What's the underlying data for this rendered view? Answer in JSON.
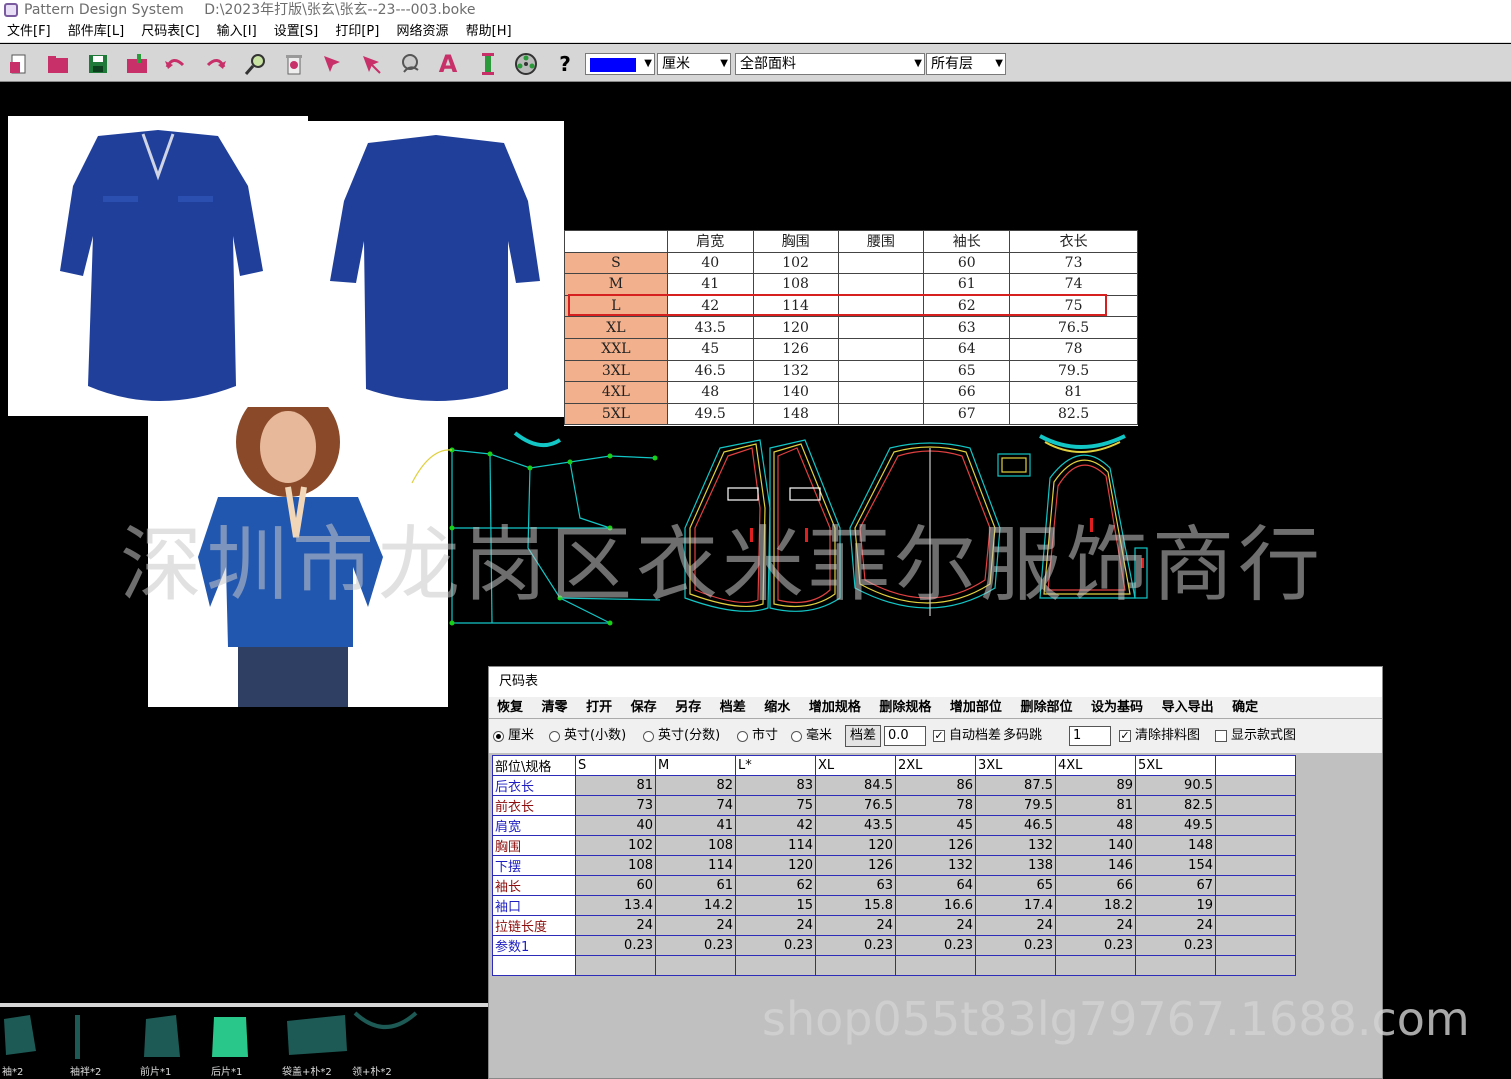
{
  "title": {
    "app": "Pattern Design System",
    "path": "D:\\2023年打版\\张玄\\张玄--23---003.boke"
  },
  "menu": [
    "文件[F]",
    "部件库[L]",
    "尺码表[C]",
    "输入[I]",
    "设置[S]",
    "打印[P]",
    "网络资源",
    "帮助[H]"
  ],
  "toolbar": {
    "icons": [
      "new-file-icon",
      "open-folder-icon",
      "save-icon",
      "import-icon",
      "undo-icon",
      "redo-icon",
      "zoom-icon",
      "delete-icon",
      "select-arrow-icon",
      "select-point-icon",
      "measure-icon",
      "text-icon",
      "grading-icon",
      "reel-icon",
      "help-icon"
    ],
    "help_label": "?",
    "text_label": "A",
    "unit": "厘米",
    "fabric": "全部面料",
    "layer": "所有层",
    "color_swatch": "#0000ff"
  },
  "size_chart_image": {
    "headers": [
      "",
      "肩宽",
      "胸围",
      "腰围",
      "袖长",
      "衣长"
    ],
    "rows": [
      [
        "S",
        "40",
        "102",
        "",
        "60",
        "73"
      ],
      [
        "M",
        "41",
        "108",
        "",
        "61",
        "74"
      ],
      [
        "L",
        "42",
        "114",
        "",
        "62",
        "75"
      ],
      [
        "XL",
        "43.5",
        "120",
        "",
        "63",
        "76.5"
      ],
      [
        "XXL",
        "45",
        "126",
        "",
        "64",
        "78"
      ],
      [
        "3XL",
        "46.5",
        "132",
        "",
        "65",
        "79.5"
      ],
      [
        "4XL",
        "48",
        "140",
        "",
        "66",
        "81"
      ],
      [
        "5XL",
        "49.5",
        "148",
        "",
        "67",
        "82.5"
      ]
    ],
    "highlight_color": "#d62020",
    "size_column_color": "#f3b08c"
  },
  "watermarks": {
    "company": "深圳市龙岗区衣米菲尔服饰商行",
    "shop": "shop055t83lg79767.1688.com"
  },
  "dialog": {
    "title": "尺码表",
    "menu": [
      "恢复",
      "清零",
      "打开",
      "保存",
      "另存",
      "档差",
      "缩水",
      "增加规格",
      "删除规格",
      "增加部位",
      "删除部位",
      "设为基码",
      "导入导出",
      "确定"
    ],
    "units": [
      "厘米",
      "英寸(小数)",
      "英寸(分数)",
      "市寸",
      "毫米"
    ],
    "selected_unit": "厘米",
    "grade_label": "档差",
    "grade_value": "0.0",
    "auto_grade_label": "自动档差",
    "multi_jump_label": "多码跳",
    "multi_jump_value": "1",
    "clear_marker_label": "清除排料图",
    "show_style_label": "显示款式图",
    "grid": {
      "corner": "部位\\规格",
      "sizes": [
        "S",
        "M",
        "L*",
        "XL",
        "2XL",
        "3XL",
        "4XL",
        "5XL"
      ],
      "rows": [
        {
          "name": "后衣长",
          "values": [
            "81",
            "82",
            "83",
            "84.5",
            "86",
            "87.5",
            "89",
            "90.5"
          ]
        },
        {
          "name": "前衣长",
          "values": [
            "73",
            "74",
            "75",
            "76.5",
            "78",
            "79.5",
            "81",
            "82.5"
          ]
        },
        {
          "name": "肩宽",
          "values": [
            "40",
            "41",
            "42",
            "43.5",
            "45",
            "46.5",
            "48",
            "49.5"
          ]
        },
        {
          "name": "胸围",
          "values": [
            "102",
            "108",
            "114",
            "120",
            "126",
            "132",
            "140",
            "148"
          ]
        },
        {
          "name": "下摆",
          "values": [
            "108",
            "114",
            "120",
            "126",
            "132",
            "138",
            "146",
            "154"
          ]
        },
        {
          "name": "袖长",
          "values": [
            "60",
            "61",
            "62",
            "63",
            "64",
            "65",
            "66",
            "67"
          ]
        },
        {
          "name": "袖口",
          "values": [
            "13.4",
            "14.2",
            "15",
            "15.8",
            "16.6",
            "17.4",
            "18.2",
            "19"
          ]
        },
        {
          "name": "拉链长度",
          "values": [
            "24",
            "24",
            "24",
            "24",
            "24",
            "24",
            "24",
            "24"
          ]
        },
        {
          "name": "参数1",
          "values": [
            "0.23",
            "0.23",
            "0.23",
            "0.23",
            "0.23",
            "0.23",
            "0.23",
            "0.23"
          ]
        }
      ]
    }
  },
  "pieces": [
    "袖*2",
    "袖袢*2",
    "前片*1",
    "后片*1",
    "袋盖+朴*2",
    "领+朴*2"
  ]
}
